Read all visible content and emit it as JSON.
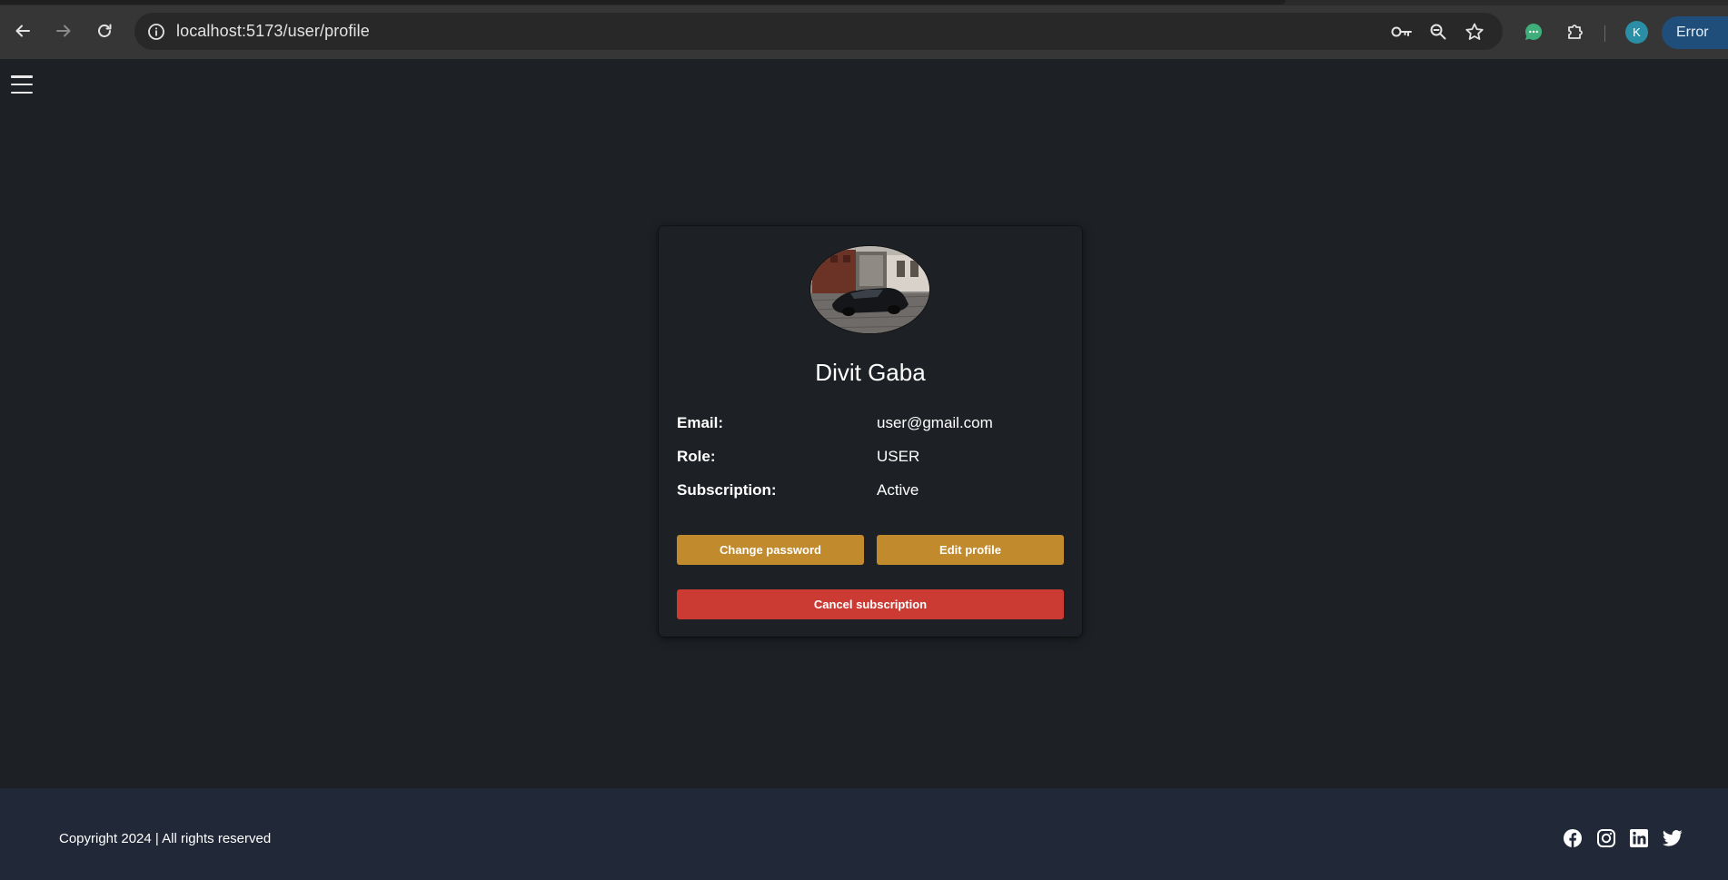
{
  "browser": {
    "url": "localhost:5173/user/profile",
    "profile_initial": "K",
    "error_label": "Error"
  },
  "profile": {
    "name": "Divit Gaba",
    "fields": [
      {
        "label": "Email:",
        "value": "user@gmail.com"
      },
      {
        "label": "Role:",
        "value": "USER"
      },
      {
        "label": "Subscription:",
        "value": "Active"
      }
    ],
    "buttons": {
      "change_password": "Change password",
      "edit_profile": "Edit profile",
      "cancel_subscription": "Cancel subscription"
    }
  },
  "footer": {
    "copyright": "Copyright 2024 | All rights reserved",
    "social": [
      "facebook-icon",
      "instagram-icon",
      "linkedin-icon",
      "twitter-icon"
    ]
  },
  "colors": {
    "page_bg": "#1d2025",
    "footer_bg": "#212837",
    "button_gold": "#c18a2d",
    "button_red": "#cb3a33"
  }
}
